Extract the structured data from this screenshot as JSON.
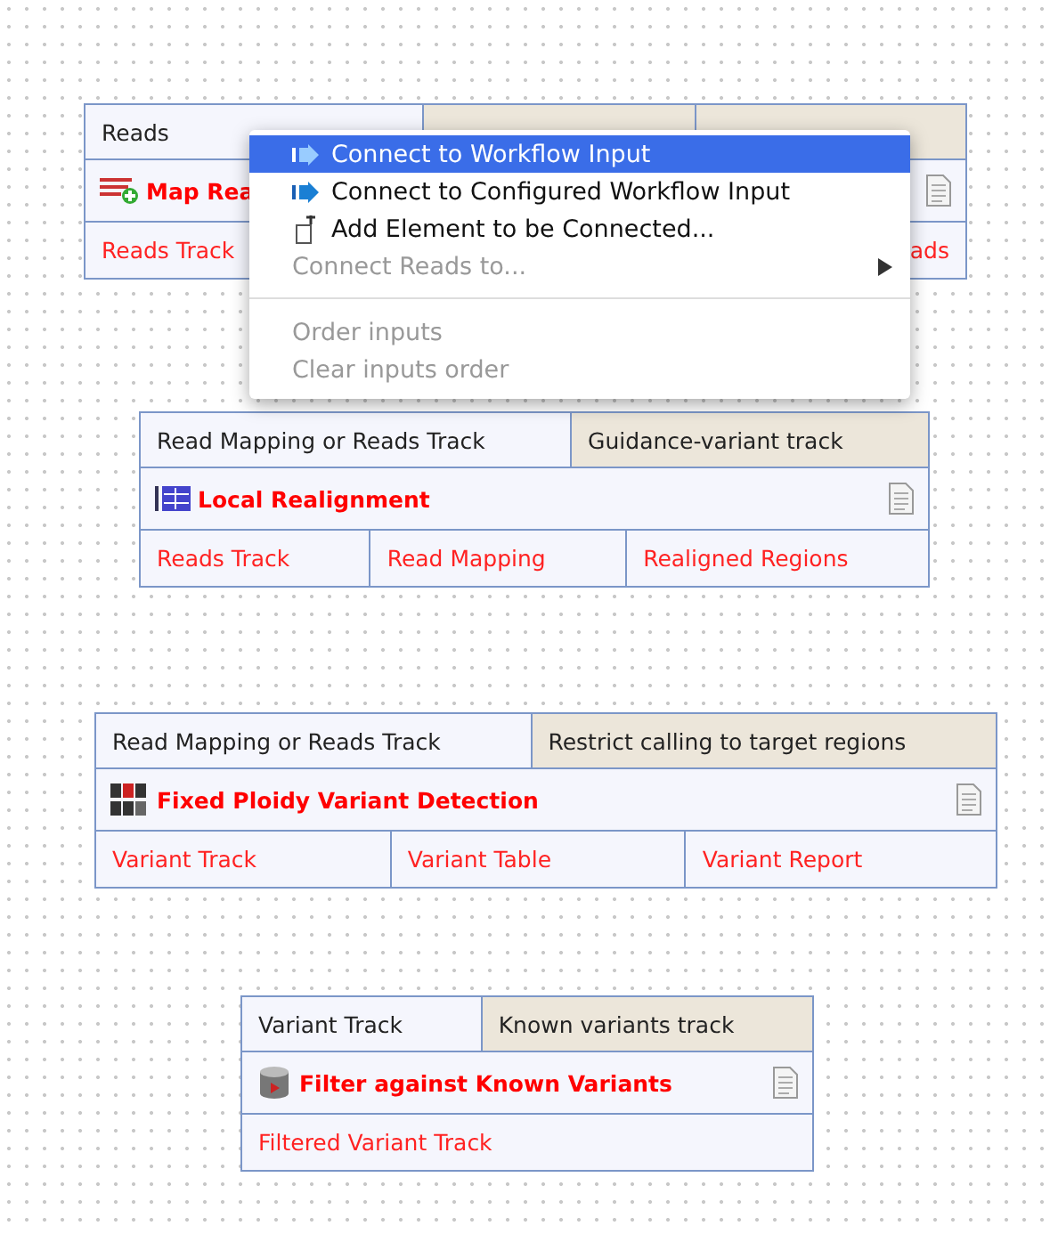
{
  "nodes": [
    {
      "title": "Map Rea",
      "inputs": [
        {
          "label": "Reads",
          "optional": false
        },
        {
          "optional": true
        },
        {
          "optional": true
        }
      ],
      "outputs": [
        {
          "label": "Reads Track"
        },
        {
          "label": "ads"
        }
      ]
    },
    {
      "title": "Local Realignment",
      "inputs": [
        {
          "label": "Read Mapping or Reads Track",
          "optional": false
        },
        {
          "label": "Guidance-variant track",
          "optional": true
        }
      ],
      "outputs": [
        {
          "label": "Reads Track"
        },
        {
          "label": "Read Mapping"
        },
        {
          "label": "Realigned Regions"
        }
      ]
    },
    {
      "title": "Fixed Ploidy Variant Detection",
      "inputs": [
        {
          "label": "Read Mapping or Reads Track",
          "optional": false
        },
        {
          "label": "Restrict calling to target regions",
          "optional": true
        }
      ],
      "outputs": [
        {
          "label": "Variant Track"
        },
        {
          "label": "Variant Table"
        },
        {
          "label": "Variant Report"
        }
      ]
    },
    {
      "title": "Filter against Known Variants",
      "inputs": [
        {
          "label": "Variant Track",
          "optional": false
        },
        {
          "label": "Known variants track",
          "optional": true
        }
      ],
      "outputs": [
        {
          "label": "Filtered Variant Track"
        }
      ]
    }
  ],
  "context_menu": {
    "items": [
      {
        "kind": "item",
        "label": "Connect to Workflow Input",
        "selected": true,
        "disabled": false
      },
      {
        "kind": "item",
        "label": "Connect to Configured Workflow Input",
        "selected": false,
        "disabled": false
      },
      {
        "kind": "item",
        "label": "Add Element to be Connected...",
        "selected": false,
        "disabled": false
      },
      {
        "kind": "submenu",
        "label": "Connect Reads to...",
        "selected": false,
        "disabled": true
      },
      {
        "kind": "separator"
      },
      {
        "kind": "item",
        "label": "Order inputs",
        "selected": false,
        "disabled": true
      },
      {
        "kind": "item",
        "label": "Clear inputs order",
        "selected": false,
        "disabled": true
      }
    ]
  }
}
